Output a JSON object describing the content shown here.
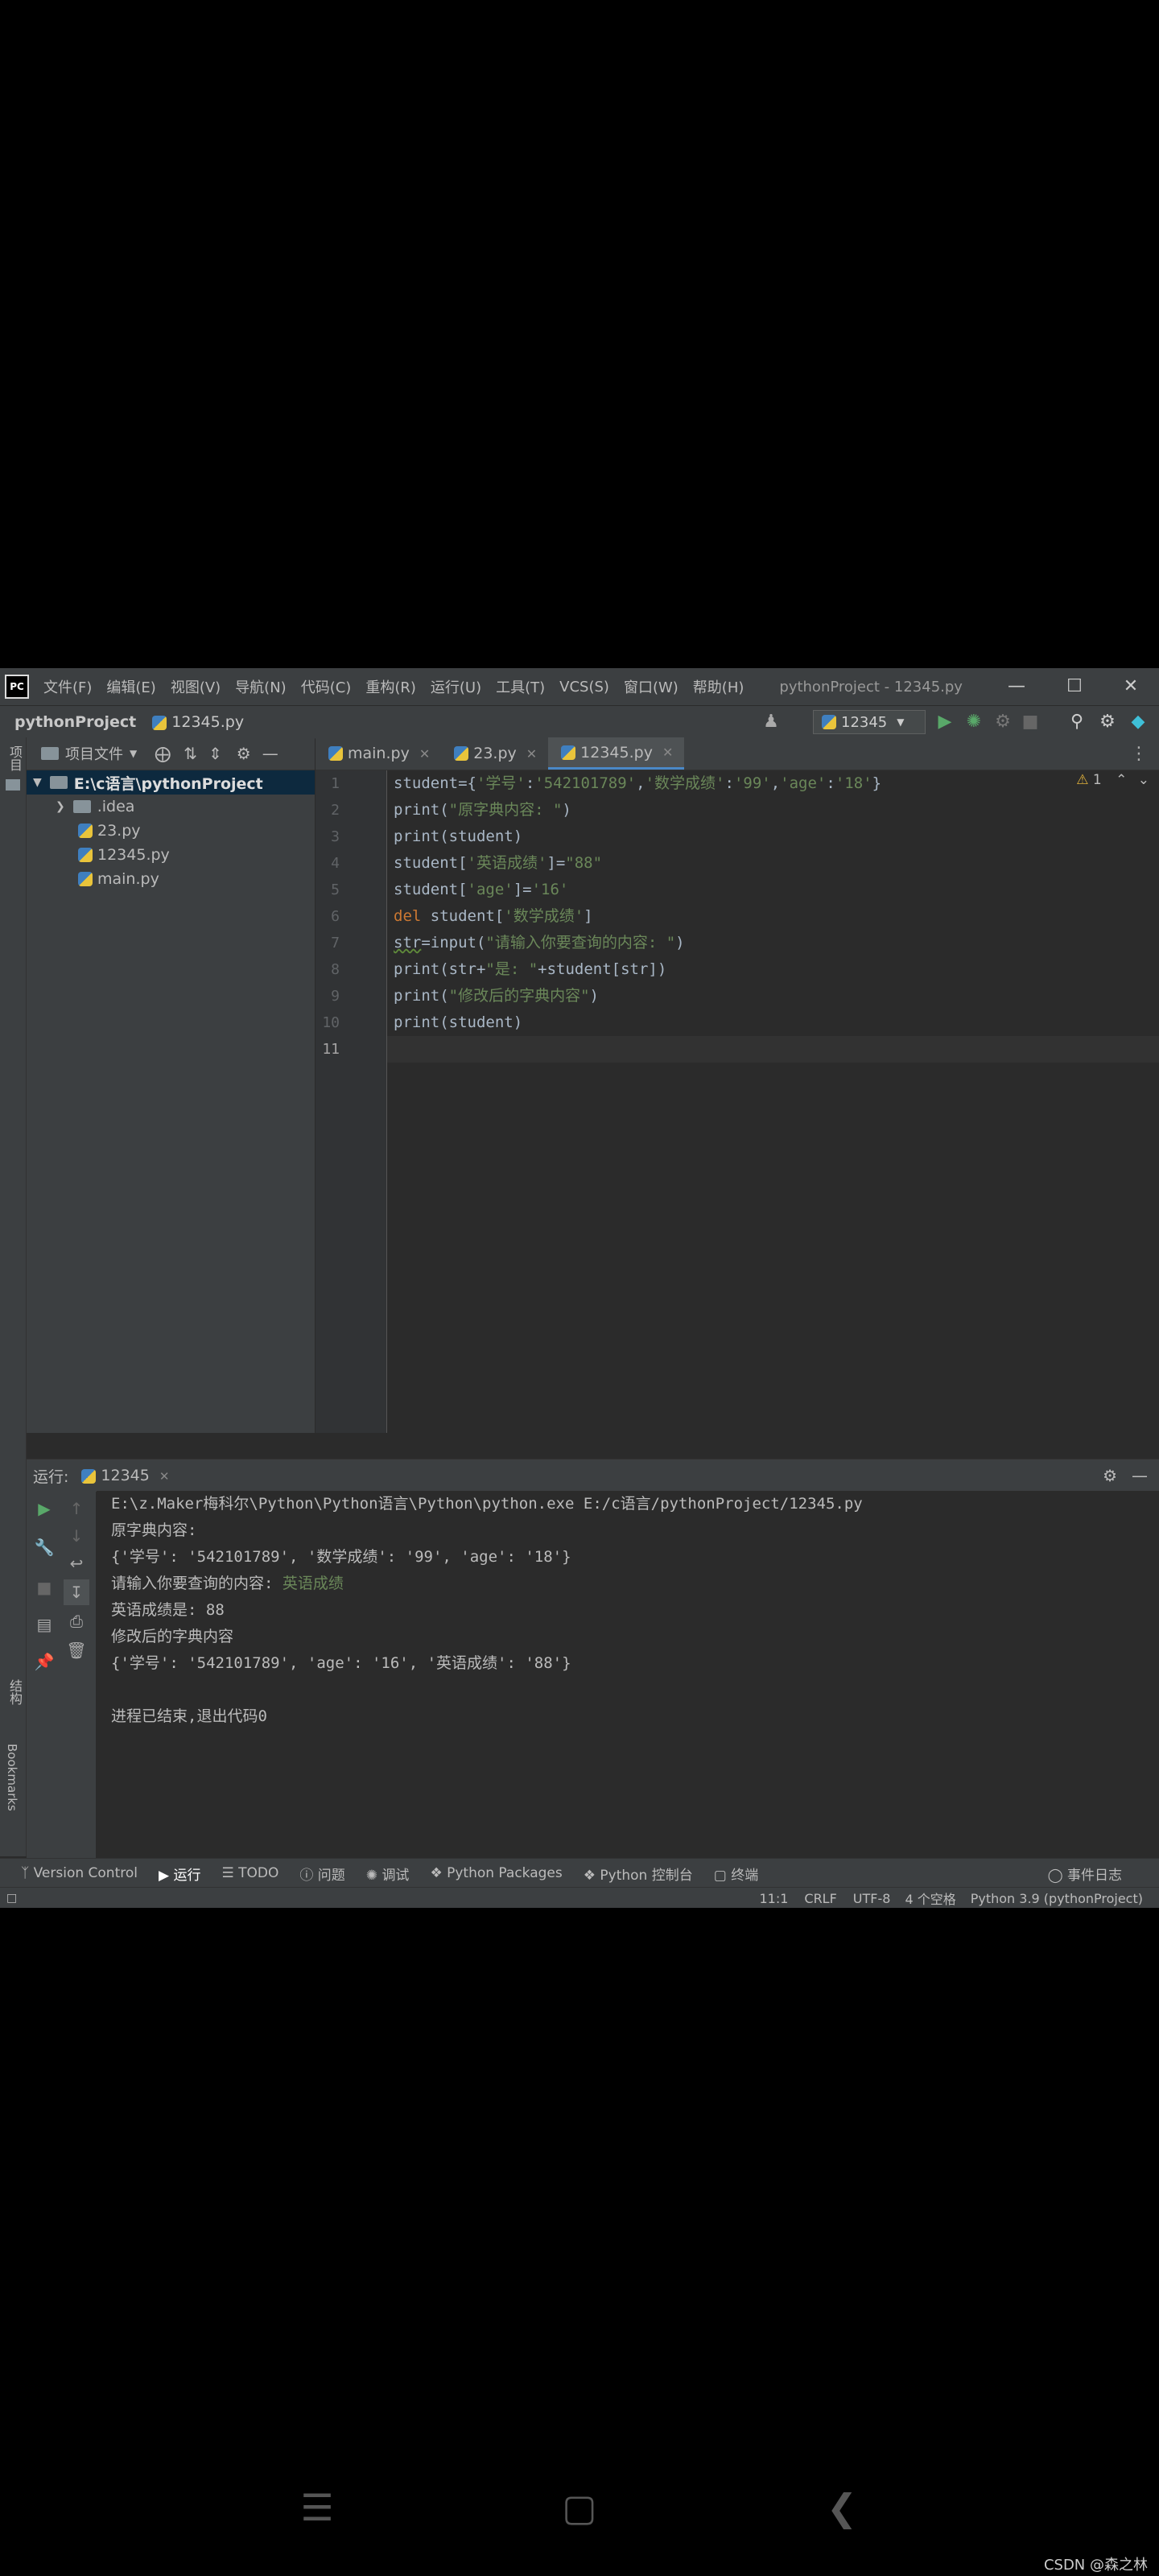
{
  "menubar": {
    "logo": "PC",
    "items": [
      "文件(F)",
      "编辑(E)",
      "视图(V)",
      "导航(N)",
      "代码(C)",
      "重构(R)",
      "运行(U)",
      "工具(T)",
      "VCS(S)",
      "窗口(W)",
      "帮助(H)"
    ],
    "window_title": "pythonProject - 12345.py",
    "minimize": "—",
    "maximize": "☐",
    "close": "✕"
  },
  "navbar": {
    "project": "pythonProject",
    "file": "12345.py",
    "run_config": "12345"
  },
  "left_strip": {
    "project_tab": "项目",
    "structure_tab": "结构",
    "bookmarks_tab": "Bookmarks"
  },
  "project_panel": {
    "header": "项目文件",
    "tree": [
      {
        "label": "E:\\c语言\\pythonProject",
        "kind": "folder",
        "level": 0
      },
      {
        "label": ".idea",
        "kind": "folder",
        "level": 1
      },
      {
        "label": "23.py",
        "kind": "file",
        "level": 2
      },
      {
        "label": "12345.py",
        "kind": "file",
        "level": 2
      },
      {
        "label": "main.py",
        "kind": "file",
        "level": 2
      }
    ]
  },
  "editor": {
    "tabs": [
      {
        "label": "main.py",
        "active": false
      },
      {
        "label": "23.py",
        "active": false
      },
      {
        "label": "12345.py",
        "active": true
      }
    ],
    "warning_count": "1",
    "line_numbers": [
      "1",
      "2",
      "3",
      "4",
      "5",
      "6",
      "7",
      "8",
      "9",
      "10",
      "11"
    ]
  },
  "run_panel": {
    "label": "运行:",
    "tab": "12345",
    "console": [
      "E:\\z.Maker梅科尔\\Python\\Python语言\\Python\\python.exe E:/c语言/pythonProject/12345.py",
      "原字典内容:",
      "{'学号': '542101789', '数学成绩': '99', 'age': '18'}",
      "请输入你要查询的内容: ",
      "英语成绩是: 88",
      "修改后的字典内容",
      "{'学号': '542101789', 'age': '16', '英语成绩': '88'}",
      "",
      "进程已结束,退出代码0"
    ],
    "user_input": "英语成绩"
  },
  "bottom_tools": [
    "Version Control",
    "运行",
    "TODO",
    "问题",
    "调试",
    "Python Packages",
    "Python 控制台",
    "终端"
  ],
  "event_log": "事件日志",
  "statusbar": {
    "position": "11:1",
    "line_sep": "CRLF",
    "encoding": "UTF-8",
    "indent": "4 个空格",
    "interpreter": "Python 3.9 (pythonProject)"
  },
  "watermark": "CSDN @森之林",
  "colors": {
    "keyword": "#cc7832",
    "string": "#6a8759",
    "identifier": "#a9b7c6",
    "selection": "#0d293e",
    "background": "#2b2b2b"
  }
}
